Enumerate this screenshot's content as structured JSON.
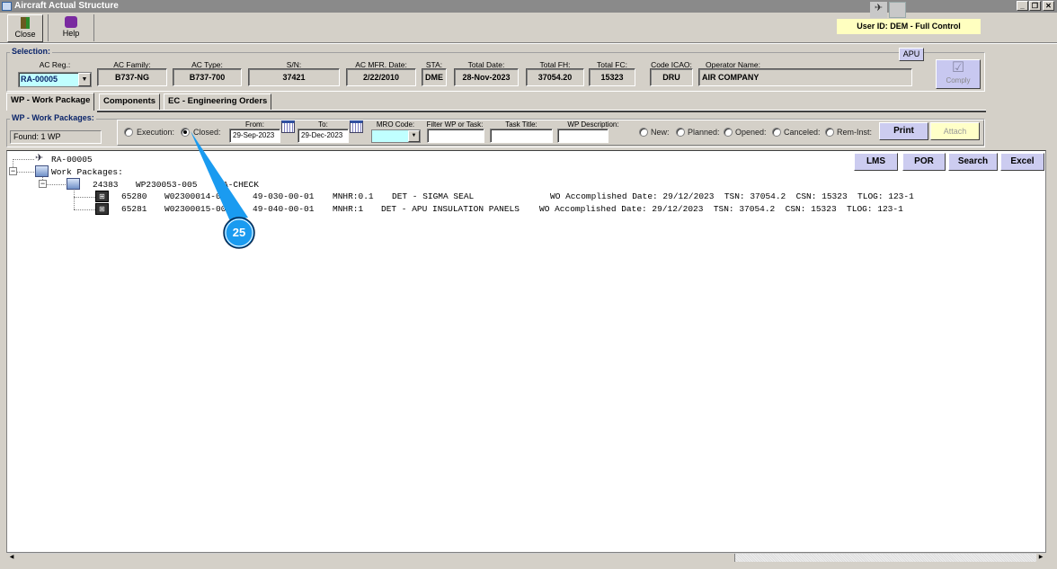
{
  "window": {
    "title": "Aircraft Actual Structure"
  },
  "toolbar": {
    "close_label": "Close",
    "help_label": "Help",
    "user_id": "User ID: DEM - Full Control"
  },
  "selection": {
    "group_label": "Selection:",
    "fields": [
      {
        "label": "AC Reg.:",
        "value": "RA-00005"
      },
      {
        "label": "AC Family:",
        "value": "B737-NG"
      },
      {
        "label": "AC Type:",
        "value": "B737-700"
      },
      {
        "label": "S/N:",
        "value": "37421"
      },
      {
        "label": "AC MFR. Date:",
        "value": "2/22/2010"
      },
      {
        "label": "STA:",
        "value": "DME"
      },
      {
        "label": "Total Date:",
        "value": "28-Nov-2023"
      },
      {
        "label": "Total FH:",
        "value": "37054.20"
      },
      {
        "label": "Total FC:",
        "value": "15323"
      },
      {
        "label": "Code ICAO:",
        "value": "DRU"
      },
      {
        "label": "Operator Name:",
        "value": "AIR COMPANY"
      }
    ],
    "apu_label": "APU",
    "comply_label": "Comply"
  },
  "tabs": [
    {
      "label": "WP - Work Package",
      "active": true
    },
    {
      "label": "Components"
    },
    {
      "label": "EC - Engineering Orders"
    }
  ],
  "wp": {
    "group_label": "WP - Work Packages:",
    "found": "Found: 1 WP",
    "radio_execution": "Execution:",
    "radio_closed": "Closed:",
    "from_label": "From:",
    "from_value": "29-Sep-2023",
    "to_label": "To:",
    "to_value": "29-Dec-2023",
    "mro_label": "MRO Code:",
    "filter_label": "Filter WP or Task:",
    "task_title_label": "Task Title:",
    "wp_desc_label": "WP Description:",
    "status_radios": [
      "New:",
      "Planned:",
      "Opened:",
      "Canceled:",
      "Rem-Inst:"
    ],
    "print_label": "Print",
    "attach_label": "Attach"
  },
  "tree_buttons": [
    "LMS",
    "POR",
    "Search",
    "Excel"
  ],
  "tree": {
    "root": "RA-00005",
    "packages_label": "Work Packages:",
    "package": {
      "id": "24383",
      "number": "WP230053-005",
      "type": "A-CHECK"
    },
    "orders": [
      {
        "id": "65280",
        "wo": "W02300014-005",
        "task": "49-030-00-01",
        "mnhr": "MNHR:0.1",
        "desc": "DET - SIGMA SEAL",
        "details": "WO Accomplished Date: 29/12/2023  TSN: 37054.2  CSN: 15323  TLOG: 123-1"
      },
      {
        "id": "65281",
        "wo": "W02300015-005",
        "task": "49-040-00-01",
        "mnhr": "MNHR:1",
        "desc": "DET - APU INSULATION PANELS",
        "details": "WO Accomplished Date: 29/12/2023  TSN: 37054.2  CSN: 15323  TLOG: 123-1"
      }
    ]
  },
  "callout": {
    "number": "25"
  },
  "colors": {
    "accent": "#1a9bf0",
    "button_lavender": "#ccccf0",
    "highlight_yellow": "#ffffc0",
    "input_cyan": "#c0ffff"
  }
}
